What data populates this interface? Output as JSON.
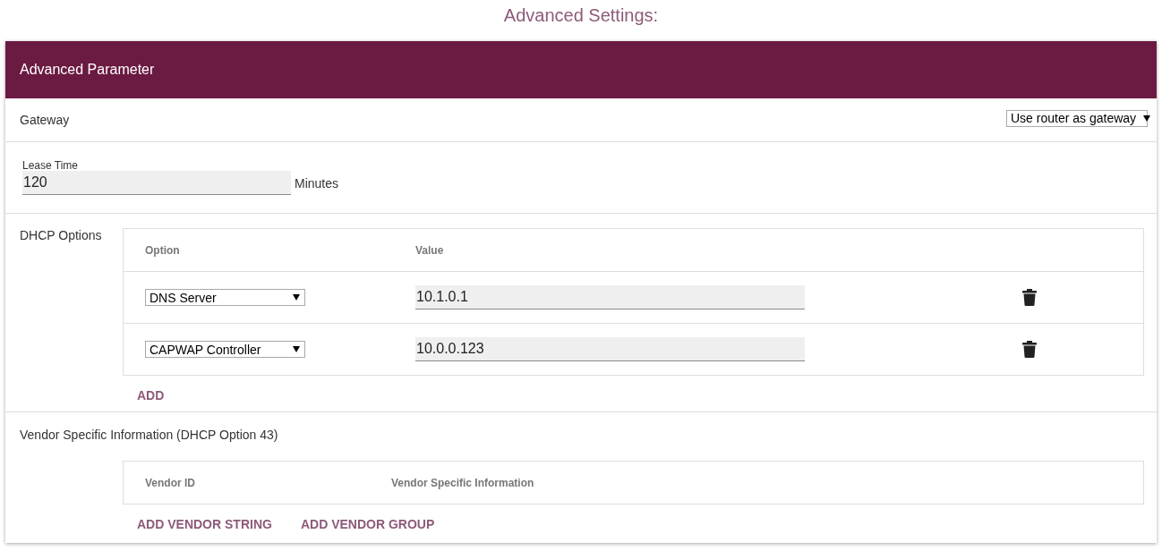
{
  "page_title": "Advanced Settings:",
  "card": {
    "title": "Advanced Parameter"
  },
  "gateway": {
    "label": "Gateway",
    "value": "Use router as gateway"
  },
  "lease_time": {
    "label": "Lease Time",
    "value": "120",
    "unit": "Minutes"
  },
  "dhcp_options": {
    "label": "DHCP Options",
    "columns": [
      "Option",
      "Value"
    ],
    "rows": [
      {
        "option": "DNS Server",
        "value": "10.1.0.1"
      },
      {
        "option": "CAPWAP Controller",
        "value": "10.0.0.123"
      }
    ],
    "add_button": "ADD"
  },
  "vendor_info": {
    "label": "Vendor Specific Information (DHCP Option 43)",
    "columns": [
      "Vendor ID",
      "Vendor Specific Information"
    ],
    "buttons": [
      "ADD VENDOR STRING",
      "ADD VENDOR GROUP"
    ]
  }
}
